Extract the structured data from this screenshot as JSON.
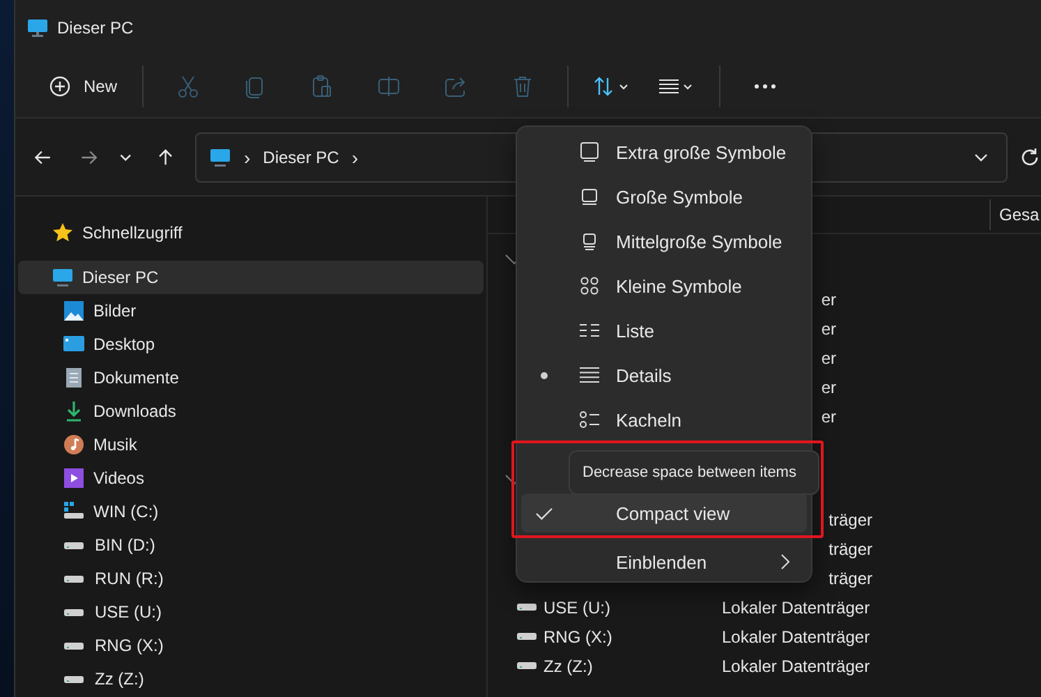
{
  "window": {
    "title": "Dieser PC"
  },
  "toolbar": {
    "new_label": "New",
    "items": [
      {
        "kind": "cut",
        "disabled": true
      },
      {
        "kind": "copy",
        "disabled": true
      },
      {
        "kind": "paste",
        "disabled": true
      },
      {
        "kind": "rename",
        "disabled": true
      },
      {
        "kind": "share",
        "disabled": true
      },
      {
        "kind": "delete",
        "disabled": true
      },
      {
        "kind": "sort",
        "disabled": false
      },
      {
        "kind": "view",
        "disabled": false
      },
      {
        "kind": "more",
        "disabled": false
      }
    ]
  },
  "address_bar": {
    "segments": [
      {
        "text": "›",
        "kind": "separator"
      },
      {
        "text": "Dieser PC",
        "kind": "crumb"
      },
      {
        "text": "›",
        "kind": "separator"
      }
    ]
  },
  "sidebar": {
    "items": [
      {
        "label": "Schnellzugriff",
        "kind": "star",
        "selected": false
      },
      {
        "label": "Dieser PC",
        "kind": "pc",
        "selected": true,
        "children": [
          {
            "label": "Bilder",
            "kind": "pictures",
            "selected": false
          },
          {
            "label": "Desktop",
            "kind": "desktop",
            "selected": false
          },
          {
            "label": "Dokumente",
            "kind": "documents",
            "selected": false
          },
          {
            "label": "Downloads",
            "kind": "downloads",
            "selected": false
          },
          {
            "label": "Musik",
            "kind": "music",
            "selected": false
          },
          {
            "label": "Videos",
            "kind": "videos",
            "selected": false
          },
          {
            "label": "WIN (C:)",
            "kind": "system-drive",
            "selected": false
          },
          {
            "label": "BIN (D:)",
            "kind": "drive",
            "selected": false
          },
          {
            "label": "RUN (R:)",
            "kind": "drive",
            "selected": false
          },
          {
            "label": "USE (U:)",
            "kind": "drive",
            "selected": false
          },
          {
            "label": "RNG (X:)",
            "kind": "drive",
            "selected": false
          },
          {
            "label": "Zz (Z:)",
            "kind": "drive",
            "selected": false
          }
        ]
      }
    ]
  },
  "content": {
    "column_header": "Gesa",
    "group_1_rows": [
      {
        "type": "er"
      },
      {
        "type": "er"
      },
      {
        "type": "er"
      },
      {
        "type": "er"
      },
      {
        "type": "er"
      }
    ],
    "group_2_rows": [
      {
        "type": "träger"
      },
      {
        "type": "träger"
      },
      {
        "type": "träger"
      },
      {
        "name": "USE (U:)",
        "type": "Lokaler Datenträger"
      },
      {
        "name": "RNG (X:)",
        "type": "Lokaler Datenträger"
      },
      {
        "name": "Zz (Z:)",
        "type": "Lokaler Datenträger"
      }
    ]
  },
  "view_menu": {
    "items": [
      {
        "label": "Extra große Symbole",
        "selected": false
      },
      {
        "label": "Große Symbole",
        "selected": false
      },
      {
        "label": "Mittelgroße Symbole",
        "selected": false
      },
      {
        "label": "Kleine Symbole",
        "selected": false
      },
      {
        "label": "Liste",
        "selected": false
      },
      {
        "label": "Details",
        "selected": true
      },
      {
        "label": "Kacheln",
        "selected": false
      }
    ],
    "compact_view": {
      "label": "Compact view",
      "checked": true,
      "highlighted": true,
      "tooltip": "Decrease space between items"
    },
    "show_submenu": {
      "label": "Einblenden"
    }
  }
}
